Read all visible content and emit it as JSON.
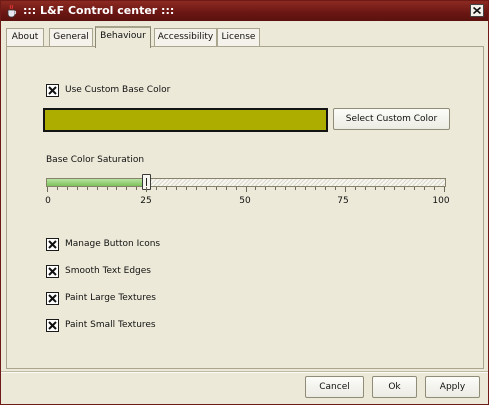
{
  "window": {
    "title": "::: L&F Control center :::",
    "close_icon": "close-icon"
  },
  "tabs": [
    {
      "label": "About",
      "active": false
    },
    {
      "label": "General",
      "active": false
    },
    {
      "label": "Behaviour",
      "active": true
    },
    {
      "label": "Accessibility",
      "active": false
    },
    {
      "label": "License",
      "active": false
    }
  ],
  "behaviour": {
    "use_custom_base_color": {
      "label": "Use Custom Base Color",
      "checked": true
    },
    "custom_color": "#adad00",
    "select_color_button": "Select Custom Color",
    "saturation": {
      "label": "Base Color Saturation",
      "value": 25,
      "min": 0,
      "max": 100,
      "tick_labels": [
        "0",
        "25",
        "50",
        "75",
        "100"
      ]
    },
    "options": [
      {
        "label": "Manage Button Icons",
        "checked": true
      },
      {
        "label": "Smooth Text Edges",
        "checked": true
      },
      {
        "label": "Paint Large Textures",
        "checked": true
      },
      {
        "label": "Paint Small Textures",
        "checked": true
      }
    ]
  },
  "footer": {
    "cancel": "Cancel",
    "ok": "Ok",
    "apply": "Apply"
  }
}
